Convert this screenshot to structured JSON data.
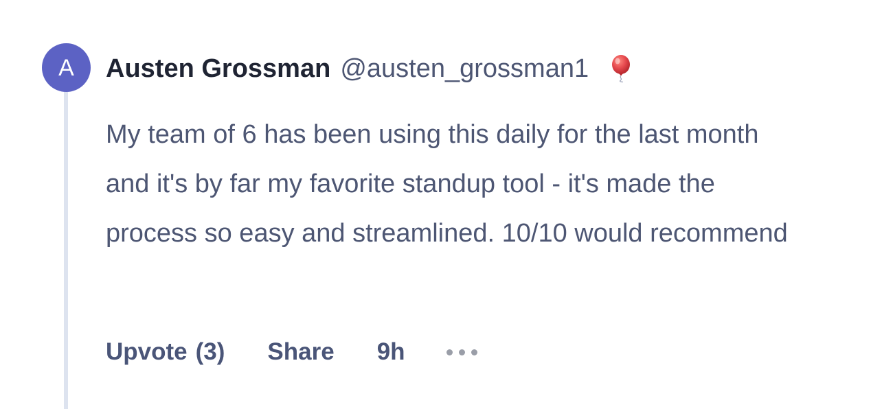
{
  "comment": {
    "avatar_initial": "A",
    "author_name": "Austen Grossman",
    "author_handle": "@austen_grossman1",
    "badge_icon": "balloon-icon",
    "body": "My team of 6 has been using this daily for the last month and it's by far my favorite standup tool - it's made the process so easy and streamlined. 10/10 would recommend",
    "actions": {
      "upvote_label": "Upvote",
      "upvote_count": "(3)",
      "share_label": "Share",
      "timestamp": "9h",
      "more_icon": "more-icon"
    }
  },
  "colors": {
    "avatar_bg": "#5c62c4",
    "thread_line": "#dde3ef",
    "name_text": "#1f2433",
    "body_text": "#4d5673",
    "action_text": "#4a5578",
    "balloon": "#e5484d"
  }
}
